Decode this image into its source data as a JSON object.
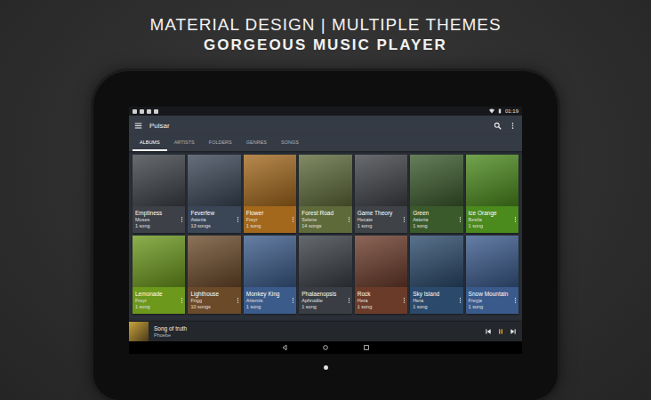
{
  "header": {
    "line1": "MATERIAL DESIGN | MULTIPLE THEMES",
    "line2": "GORGEOUS MUSIC PLAYER"
  },
  "status_bar": {
    "time": "01:19"
  },
  "app_bar": {
    "title": "Pulsar"
  },
  "tabs": [
    {
      "label": "ALBUMS",
      "selected": true
    },
    {
      "label": "ARTISTS",
      "selected": false
    },
    {
      "label": "FOLDERS",
      "selected": false
    },
    {
      "label": "GENRES",
      "selected": false
    },
    {
      "label": "SONGS",
      "selected": false
    }
  ],
  "albums": [
    {
      "title": "Emptiness",
      "artist": "Muses",
      "songs": "1 song",
      "color": "#3d4147"
    },
    {
      "title": "Feverfew",
      "artist": "Asteria",
      "songs": "13 songs",
      "color": "#3a4656"
    },
    {
      "title": "Flower",
      "artist": "Freyr",
      "songs": "1 song",
      "color": "#a3681c"
    },
    {
      "title": "Forest Road",
      "artist": "Selene",
      "songs": "14 songs",
      "color": "#5e6a3a"
    },
    {
      "title": "Game Theory",
      "artist": "Hecate",
      "songs": "1 song",
      "color": "#3f4247"
    },
    {
      "title": "Green",
      "artist": "Asteria",
      "songs": "1 song",
      "color": "#3b5a2c"
    },
    {
      "title": "Ice Orange",
      "artist": "Bestla",
      "songs": "1 song",
      "color": "#4b8a1c"
    },
    {
      "title": "Lemonade",
      "artist": "Freyr",
      "songs": "1 song",
      "color": "#6c981c"
    },
    {
      "title": "Lighthouse",
      "artist": "Frigg",
      "songs": "10 songs",
      "color": "#6b4a2a"
    },
    {
      "title": "Monkey King",
      "artist": "Artemis",
      "songs": "1 song",
      "color": "#3b5b8a"
    },
    {
      "title": "Phalaenopsis",
      "artist": "Aphrodite",
      "songs": "1 song",
      "color": "#3a3e44"
    },
    {
      "title": "Rock",
      "artist": "Hera",
      "songs": "1 song",
      "color": "#6b3b2a"
    },
    {
      "title": "Sky Island",
      "artist": "Hera",
      "songs": "1 song",
      "color": "#2b4a6b"
    },
    {
      "title": "Snow Mountain",
      "artist": "Freyja",
      "songs": "1 song",
      "color": "#3a5a8c"
    }
  ],
  "now_playing": {
    "title": "Song of truth",
    "artist": "Phoebe",
    "playing": true
  }
}
